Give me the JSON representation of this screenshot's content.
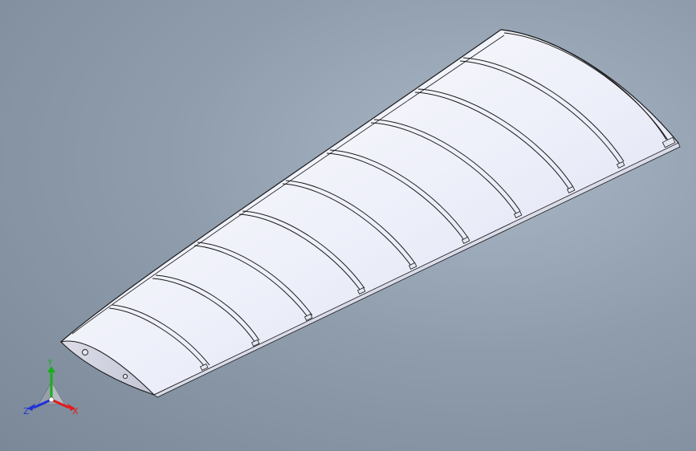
{
  "viewport": {
    "background_colors": [
      "#a9b6c5",
      "#8f9dad",
      "#7a8898"
    ]
  },
  "model": {
    "kind": "wing-assembly",
    "skin_color": "#eef0fa",
    "shadow_color": "#c8cbe0",
    "edge_color": "#1a1a1a",
    "rib_count": 10
  },
  "triad": {
    "x_label": "X",
    "y_label": "Y",
    "z_label": "Z",
    "x_color": "#e11b1b",
    "y_color": "#18b018",
    "z_color": "#2030d8"
  }
}
